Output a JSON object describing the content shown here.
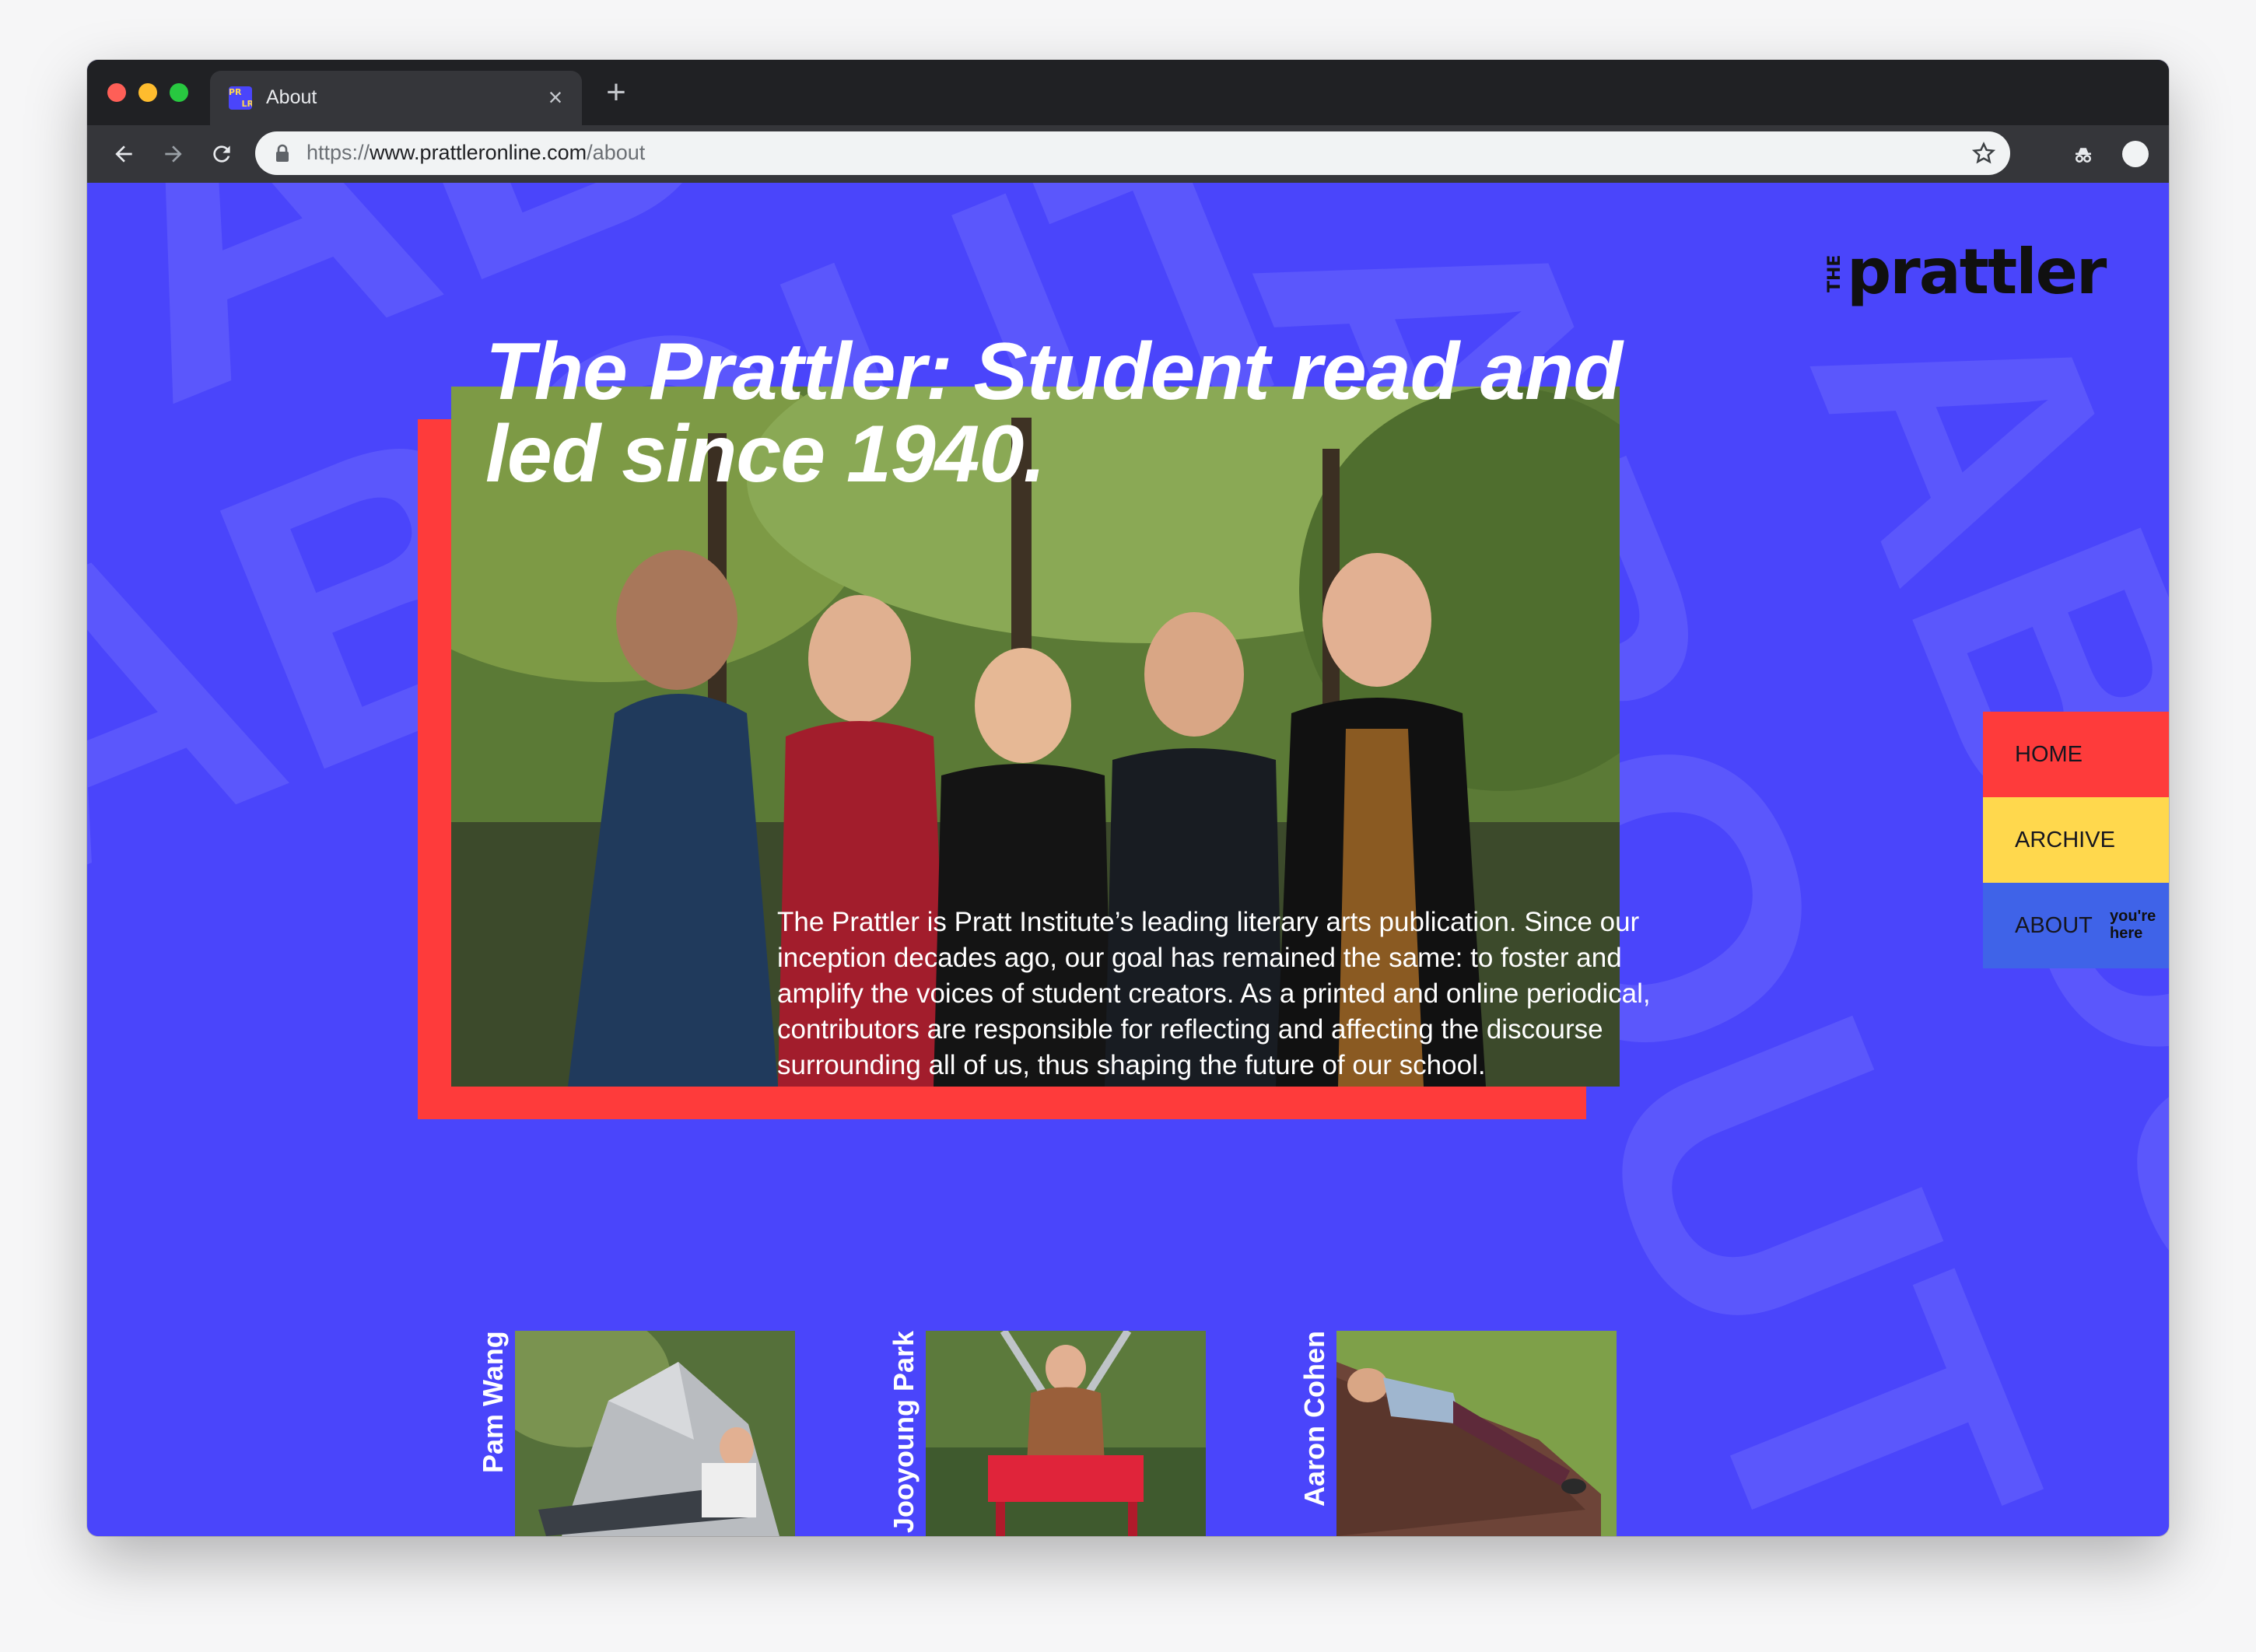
{
  "browser": {
    "tab_title": "About",
    "favicon_letters": [
      "PR",
      "LR"
    ],
    "url_scheme": "https://",
    "url_host": "www.prattleronline.com",
    "url_path": "/about"
  },
  "brand": {
    "logo_prefix": "THE",
    "logo_name": "prattler"
  },
  "background_words": [
    "ABOUT",
    "ABOUT",
    "ABOUT",
    "ABOUT"
  ],
  "hero": {
    "title": "The Prattler: Student read and led since 1940.",
    "description": "The Prattler is Pratt Institute’s leading literary arts publication. Since our inception decades ago, our goal has remained the same: to foster and amplify the voices of student creators. As a printed and online periodical, contributors are responsible for reflecting and affecting the discourse surrounding all of us, thus shaping the future of our school."
  },
  "nav": {
    "items": [
      {
        "label": "HOME"
      },
      {
        "label": "ARCHIVE"
      },
      {
        "label": "ABOUT",
        "note": "you're here"
      }
    ]
  },
  "team": [
    {
      "name": "Pam Wang"
    },
    {
      "name": "Jooyoung Park"
    },
    {
      "name": "Aaron Cohen"
    }
  ],
  "colors": {
    "page_bg": "#4a45fb",
    "accent_red": "#fe3b3b",
    "accent_yellow": "#ffd84d",
    "accent_blue": "#3f63e8"
  }
}
